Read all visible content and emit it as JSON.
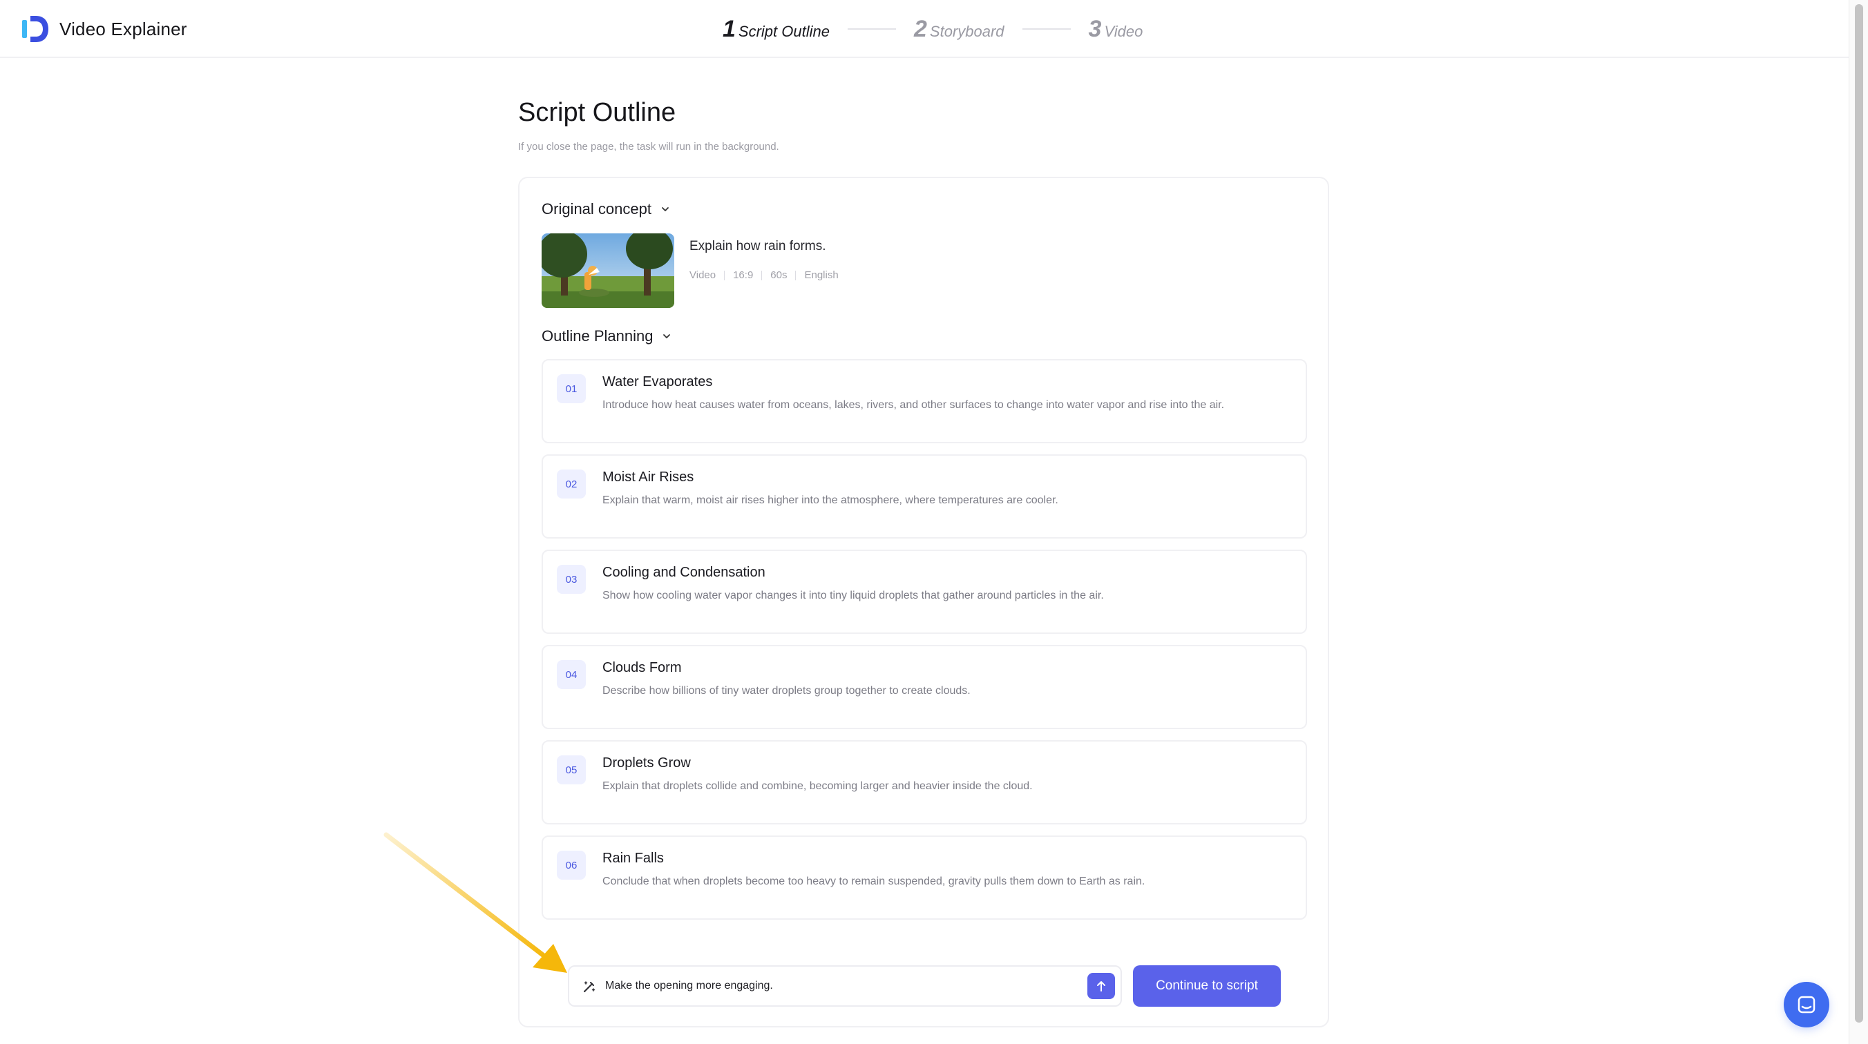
{
  "app": {
    "name": "Video Explainer"
  },
  "steps": [
    {
      "num": "1",
      "label": "Script Outline"
    },
    {
      "num": "2",
      "label": "Storyboard"
    },
    {
      "num": "3",
      "label": "Video"
    }
  ],
  "page": {
    "title": "Script Outline",
    "subtitle": "If you close the page, the task will run in the background."
  },
  "concept": {
    "section_label": "Original concept",
    "text": "Explain how rain forms.",
    "meta": [
      "Video",
      "16:9",
      "60s",
      "English"
    ]
  },
  "outline": {
    "section_label": "Outline Planning",
    "items": [
      {
        "num": "01",
        "title": "Water Evaporates",
        "desc": "Introduce how heat causes water from oceans, lakes, rivers, and other surfaces to change into water vapor and rise into the air."
      },
      {
        "num": "02",
        "title": "Moist Air Rises",
        "desc": "Explain that warm, moist air rises higher into the atmosphere, where temperatures are cooler."
      },
      {
        "num": "03",
        "title": "Cooling and Condensation",
        "desc": "Show how cooling water vapor changes it into tiny liquid droplets that gather around particles in the air."
      },
      {
        "num": "04",
        "title": "Clouds Form",
        "desc": "Describe how billions of tiny water droplets group together to create clouds."
      },
      {
        "num": "05",
        "title": "Droplets Grow",
        "desc": "Explain that droplets collide and combine, becoming larger and heavier inside the cloud."
      },
      {
        "num": "06",
        "title": "Rain Falls",
        "desc": "Conclude that when droplets become too heavy to remain suspended, gravity pulls them down to Earth as rain."
      }
    ]
  },
  "input": {
    "value": "Make the opening more engaging."
  },
  "actions": {
    "continue_label": "Continue to script"
  },
  "colors": {
    "accent": "#5a62ea",
    "annotation_arrow": "#f5b70a",
    "chat_button": "#3f6cf0"
  },
  "icons": {
    "send": "arrow-up-icon",
    "wand": "magic-wand-icon",
    "chat": "chat-icon"
  }
}
